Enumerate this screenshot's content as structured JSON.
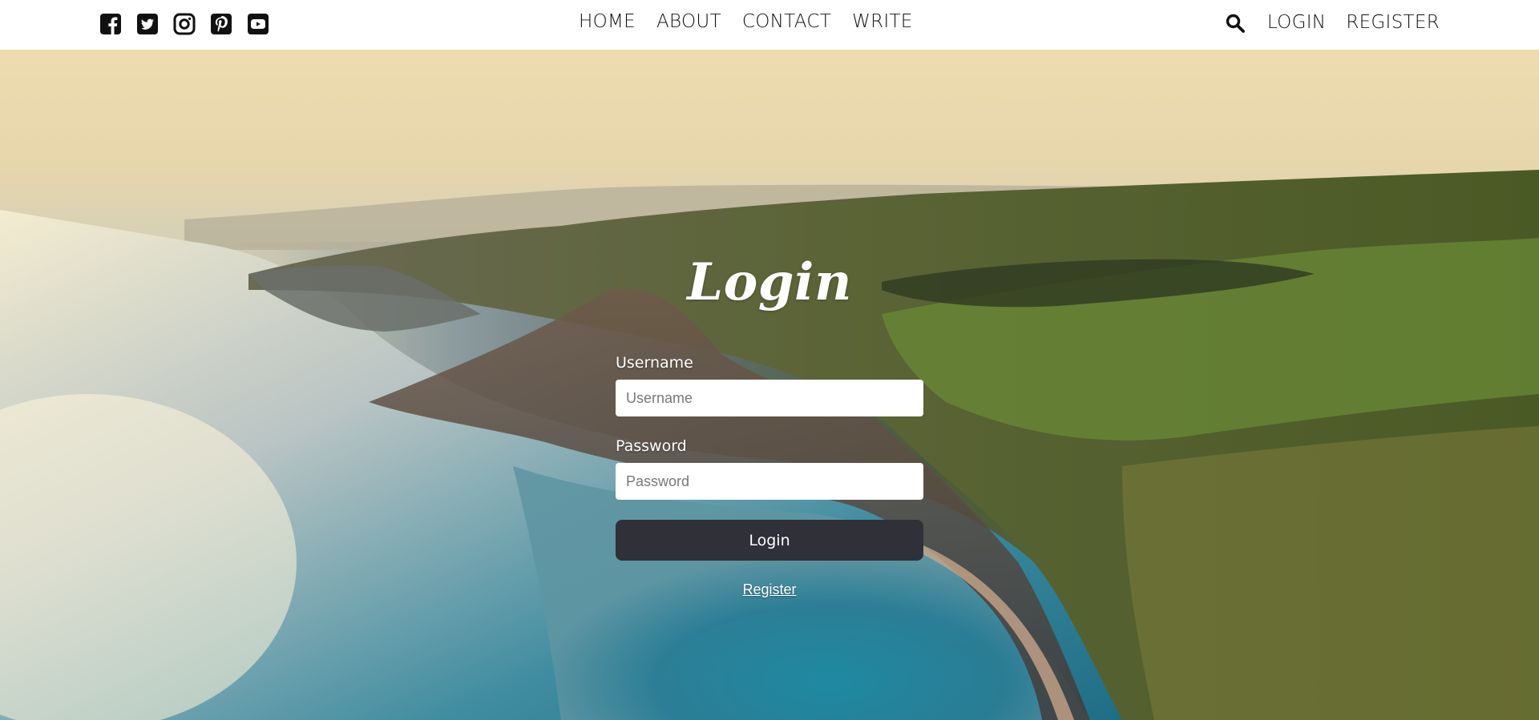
{
  "header": {
    "social_icons": [
      "facebook-icon",
      "twitter-icon",
      "instagram-icon",
      "pinterest-icon",
      "youtube-icon"
    ],
    "nav": {
      "home": "HOME",
      "about": "ABOUT",
      "contact": "CONTACT",
      "write": "WRITE"
    },
    "search_icon": "search-icon",
    "auth": {
      "login": "LOGIN",
      "register": "REGISTER"
    }
  },
  "login_form": {
    "title": "Login",
    "username_label": "Username",
    "username_placeholder": "Username",
    "username_value": "",
    "password_label": "Password",
    "password_placeholder": "Password",
    "password_value": "",
    "submit_label": "Login",
    "register_link": "Register"
  },
  "colors": {
    "button_bg": "#2f3038",
    "header_bg": "#ffffff",
    "nav_text": "#111111"
  }
}
